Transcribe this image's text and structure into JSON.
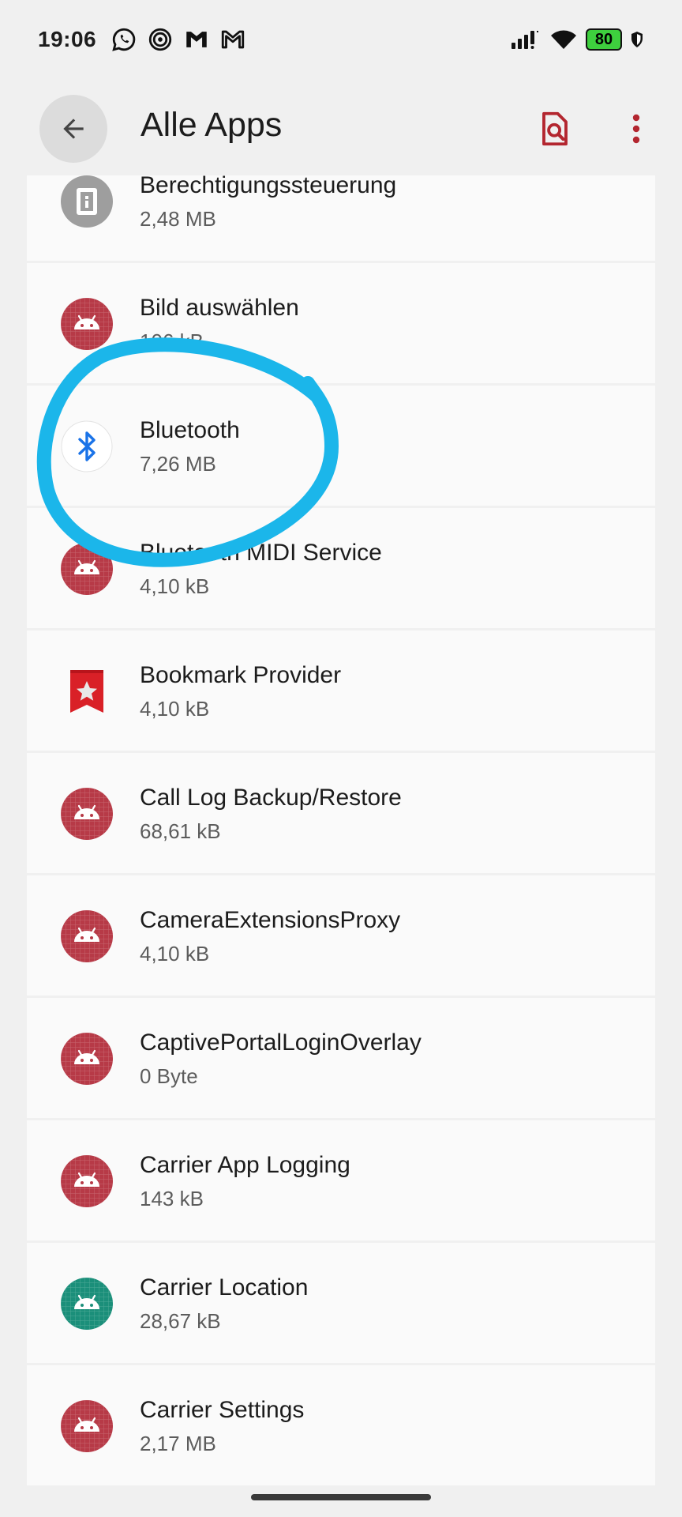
{
  "status_bar": {
    "time": "19:06",
    "notification_icons": [
      "whatsapp-icon",
      "signal-icon",
      "gmail-icon",
      "gmail-outline-icon"
    ],
    "battery": "80"
  },
  "header": {
    "title": "Alle Apps",
    "back_icon": "arrow-left-icon",
    "find_icon": "search-document-icon",
    "more_icon": "more-vert-icon"
  },
  "apps": [
    {
      "name": "Berechtigungssteuerung",
      "size": "2,48 MB",
      "icon": "permission-controller-icon"
    },
    {
      "name": "Bild auswählen",
      "size": "106 kB",
      "icon": "android-icon"
    },
    {
      "name": "Bluetooth",
      "size": "7,26 MB",
      "icon": "bluetooth-icon"
    },
    {
      "name": "Bluetooth MIDI Service",
      "size": "4,10 kB",
      "icon": "android-icon"
    },
    {
      "name": "Bookmark Provider",
      "size": "4,10 kB",
      "icon": "bookmark-icon"
    },
    {
      "name": "Call Log Backup/Restore",
      "size": "68,61 kB",
      "icon": "android-icon"
    },
    {
      "name": "CameraExtensionsProxy",
      "size": "4,10 kB",
      "icon": "android-icon"
    },
    {
      "name": "CaptivePortalLoginOverlay",
      "size": "0 Byte",
      "icon": "android-icon"
    },
    {
      "name": "Carrier App Logging",
      "size": "143 kB",
      "icon": "android-icon"
    },
    {
      "name": "Carrier Location",
      "size": "28,67 kB",
      "icon": "android-icon-green"
    },
    {
      "name": "Carrier Settings",
      "size": "2,17 MB",
      "icon": "android-icon"
    }
  ],
  "colors": {
    "android_red": "#b73a47",
    "android_green": "#1b8f7a",
    "bluetooth_blue": "#1a73e8",
    "accent": "#b3262f",
    "annotation_blue": "#1bb6ea"
  }
}
